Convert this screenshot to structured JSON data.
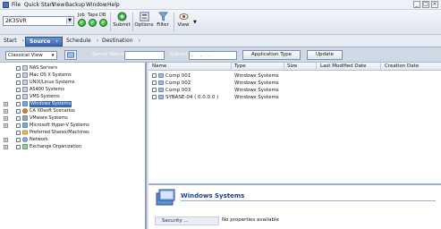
{
  "menubar": {
    "items": [
      "File",
      "Quick Start",
      "View",
      "Backup",
      "Window",
      "Help"
    ],
    "window_controls": [
      "_",
      "□",
      "×"
    ]
  },
  "toolbar": {
    "server": "2K3SVR",
    "job_label": "Job",
    "tape_label": "Tape",
    "db_label": "DB",
    "submit_label": "Submit",
    "options_label": "Options",
    "filter_label": "Filter",
    "view_label": "View"
  },
  "tabs": [
    {
      "label": "Start"
    },
    {
      "label": "Source"
    },
    {
      "label": "Schedule"
    },
    {
      "label": "Destination"
    }
  ],
  "filterbar": {
    "view_value": "Classical View",
    "server_name_label": "Server Name",
    "server_name_value": "",
    "subnet_label": "Subnet",
    "subnet_value": ". . .",
    "app_type_button": "Application Type",
    "update_button": "Update"
  },
  "tree": {
    "items": [
      {
        "label": "NAS Servers",
        "selected": false
      },
      {
        "label": "Mac OS X Systems",
        "selected": false
      },
      {
        "label": "UNIX/Linux Systems",
        "selected": false
      },
      {
        "label": "AS400 Systems",
        "selected": false
      },
      {
        "label": "VMS Systems",
        "selected": false
      },
      {
        "label": "Windows Systems",
        "selected": true
      },
      {
        "label": "CA XOsoft Scenarios",
        "selected": false
      },
      {
        "label": "VMware Systems",
        "selected": false
      },
      {
        "label": "Microsoft Hyper-V Systems",
        "selected": false
      },
      {
        "label": "Preferred Shares/Machines",
        "selected": false
      },
      {
        "label": "Network",
        "selected": false
      },
      {
        "label": "Exchange Organization",
        "selected": false
      }
    ]
  },
  "list": {
    "columns": [
      "Name",
      "Type",
      "Size",
      "Last Modified Date",
      "Creation Date"
    ],
    "rows": [
      {
        "name": "Comp 001",
        "type": "Windows Systems"
      },
      {
        "name": "Comp 002",
        "type": "Windows Systems"
      },
      {
        "name": "Comp 003",
        "type": "Windows Systems"
      },
      {
        "name": "SYBASE-04 ( 0.0.0.0 )",
        "type": "Windows Systems"
      }
    ]
  },
  "detail": {
    "title": "Windows Systems",
    "security_link": "Security ...",
    "message": "No properties available"
  },
  "colors": {
    "accent": "#3a68b4",
    "status_green": "#1f9a24"
  }
}
